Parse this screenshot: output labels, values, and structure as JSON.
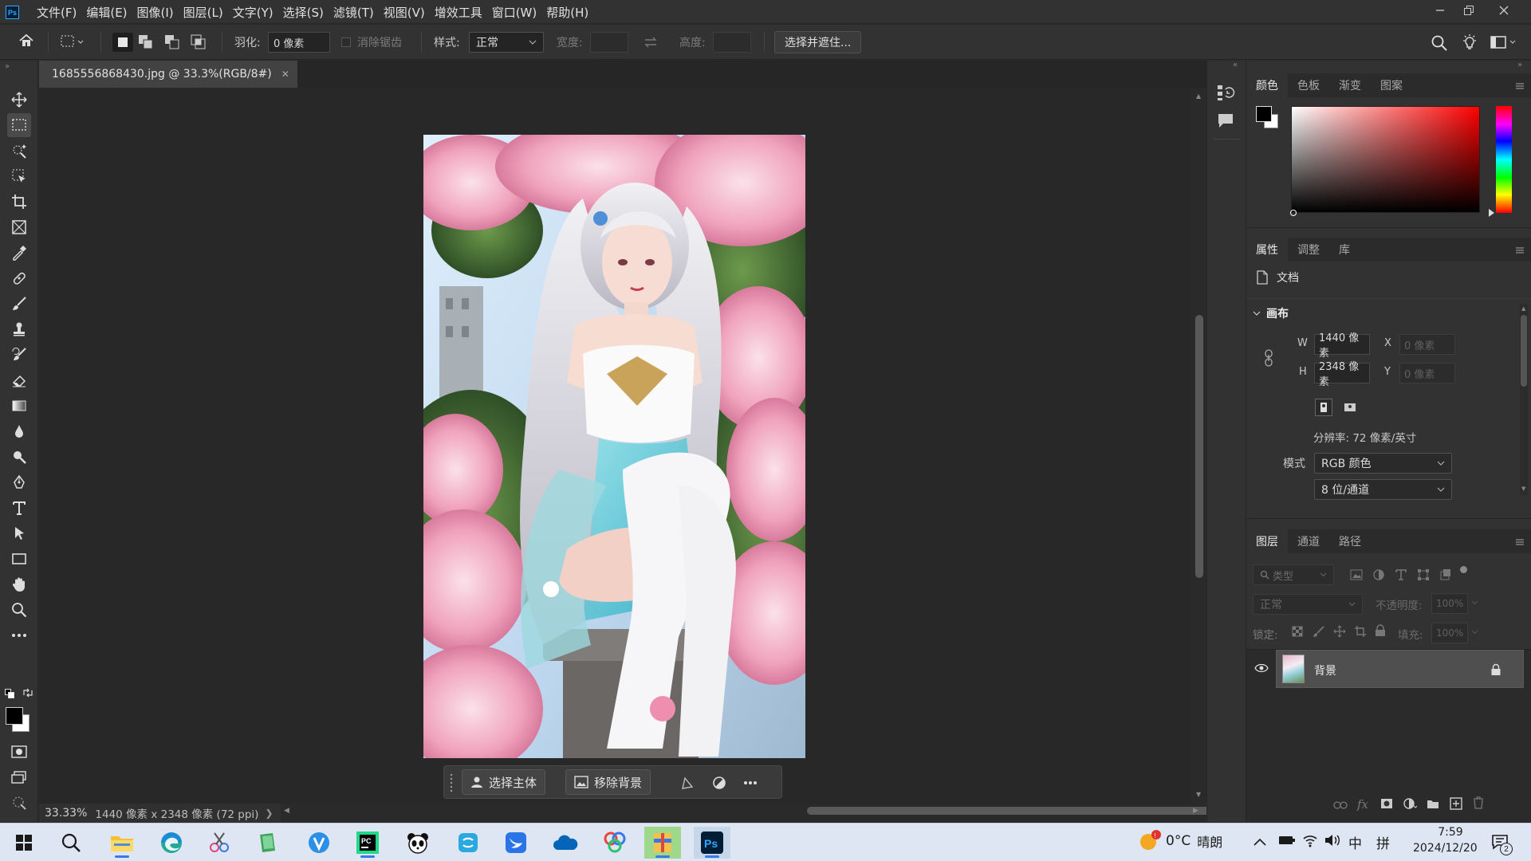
{
  "app": {
    "logo": "Ps",
    "menu": [
      "文件(F)",
      "编辑(E)",
      "图像(I)",
      "图层(L)",
      "文字(Y)",
      "选择(S)",
      "滤镜(T)",
      "视图(V)",
      "增效工具",
      "窗口(W)",
      "帮助(H)"
    ]
  },
  "options_bar": {
    "feather_label": "羽化:",
    "feather_value": "0 像素",
    "antialias_label": "消除锯齿",
    "style_label": "样式:",
    "style_value": "正常",
    "width_label": "宽度:",
    "height_label": "高度:",
    "select_mask_button": "选择并遮住..."
  },
  "document": {
    "tab_title": "1685556868430.jpg @ 33.3%(RGB/8#)",
    "zoom": "33.33%",
    "size_info": "1440 像素 x 2348 像素 (72 ppi)"
  },
  "contextual_bar": {
    "select_subject": "选择主体",
    "remove_background": "移除背景"
  },
  "color_panel": {
    "tabs": [
      "颜色",
      "色板",
      "渐变",
      "图案"
    ],
    "foreground": "#000000",
    "background": "#ffffff",
    "hue_color": "#ff0000"
  },
  "properties_panel": {
    "tabs": [
      "属性",
      "调整",
      "库"
    ],
    "doc_label": "文档",
    "canvas_section": "画布",
    "w_label": "W",
    "w_value": "1440 像素",
    "h_label": "H",
    "h_value": "2348 像素",
    "x_label": "X",
    "x_placeholder": "0 像素",
    "y_label": "Y",
    "y_placeholder": "0 像素",
    "resolution": "分辨率: 72 像素/英寸",
    "mode_label": "模式",
    "mode_value": "RGB 颜色",
    "bit_depth": "8 位/通道"
  },
  "layers_panel": {
    "tabs": [
      "图层",
      "通道",
      "路径"
    ],
    "filter_placeholder": "类型",
    "blend_mode": "正常",
    "opacity_label": "不透明度:",
    "opacity_value": "100%",
    "lock_label": "锁定:",
    "fill_label": "填充:",
    "fill_value": "100%",
    "layers": [
      {
        "name": "背景",
        "visible": true,
        "locked": true
      }
    ]
  },
  "taskbar": {
    "weather_temp": "0°C",
    "weather_text": "晴朗",
    "ime_lang": "中",
    "ime_mode": "拼",
    "time": "7:59",
    "date": "2024/12/20",
    "notification_count": "2"
  }
}
